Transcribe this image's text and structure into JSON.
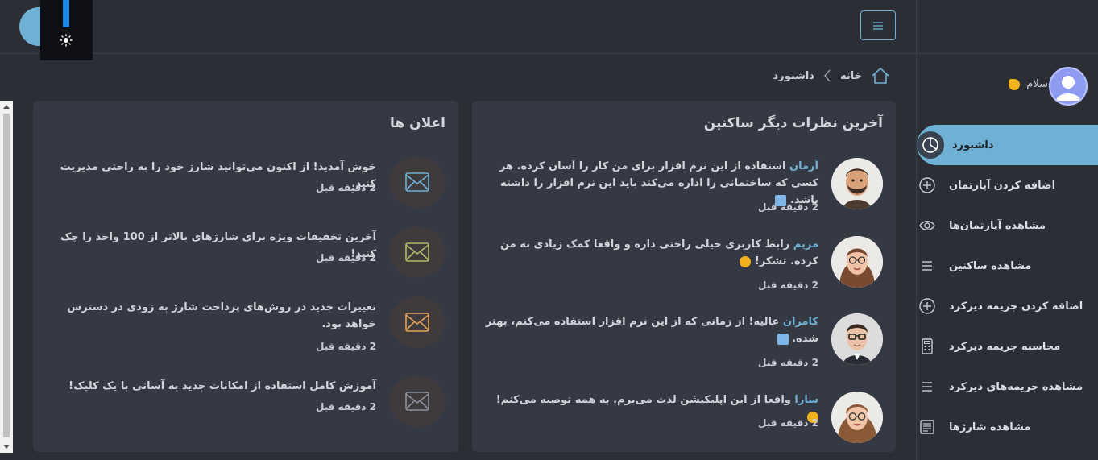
{
  "header": {
    "menu_button": "hamburger-icon",
    "theme_toggle": "sun-icon"
  },
  "sidebar": {
    "greeting": "سلام",
    "items": [
      {
        "label": "داشبورد",
        "icon": "pie-chart-icon",
        "active": true
      },
      {
        "label": "اضافه کردن آپارتمان",
        "icon": "plus-circle-icon"
      },
      {
        "label": "مشاهده آپارتمان‌ها",
        "icon": "eye-icon"
      },
      {
        "label": "مشاهده ساکنین",
        "icon": "list-icon"
      },
      {
        "label": "اضافه کردن جریمه دیرکرد",
        "icon": "plus-circle-icon"
      },
      {
        "label": "محاسبه جریمه دیرکرد",
        "icon": "calculator-icon"
      },
      {
        "label": "مشاهده جریمه‌های دیرکرد",
        "icon": "list-icon"
      },
      {
        "label": "مشاهده شارژها",
        "icon": "receipt-icon"
      }
    ]
  },
  "breadcrumb": {
    "home": "خانه",
    "current": "داشبورد"
  },
  "comments": {
    "title": "آخرین نظرات دیگر ساکنین",
    "items": [
      {
        "name": "آرمان",
        "text": "استفاده از این نرم افزار برای من کار را آسان کرده. هر کسی که ساختمانی را اداره می‌کند باید این نرم افزار را داشته باشد.",
        "time": "2 دقیقه قبل"
      },
      {
        "name": "مریم",
        "text": "رابط کاربری خیلی راحتی داره و واقعا کمک زیادی به من کرده. تشکر!",
        "time": "2 دقیقه قبل"
      },
      {
        "name": "کامران",
        "text": "عالیه! از زمانی که از این نرم افزار استفاده می‌کنم، بهتر شده.",
        "time": "2 دقیقه قبل"
      },
      {
        "name": "سارا",
        "text": "واقعا از این اپلیکیشن لذت می‌برم. به همه توصیه می‌کنم!",
        "time": "2 دقیقه قبل"
      }
    ]
  },
  "notices": {
    "title": "اعلان ها",
    "items": [
      {
        "text": "خوش آمدید! از اکنون می‌توانید شارژ خود را به راحتی مدیریت کنید.",
        "time": "2 دقیقه قبل",
        "color": "#6fb1d4"
      },
      {
        "text": "آخرین تخفیفات ویژه برای شارژهای بالاتر از 100 واحد را چک کنید!",
        "time": "2 دقیقه قبل",
        "color": "#b5b86a"
      },
      {
        "text": "تغییرات جدید در روش‌های پرداخت شارژ به زودی در دسترس خواهد بود.",
        "time": "2 دقیقه قبل",
        "color": "#e0a35a"
      },
      {
        "text": "آموزش کامل استفاده از امکانات جدید به آسانی با یک کلیک!",
        "time": "2 دقیقه قبل",
        "color": "#8a8f99"
      }
    ]
  },
  "colors": {
    "accent": "#6fb1d4",
    "background": "#2b2e35",
    "card": "#353943"
  }
}
